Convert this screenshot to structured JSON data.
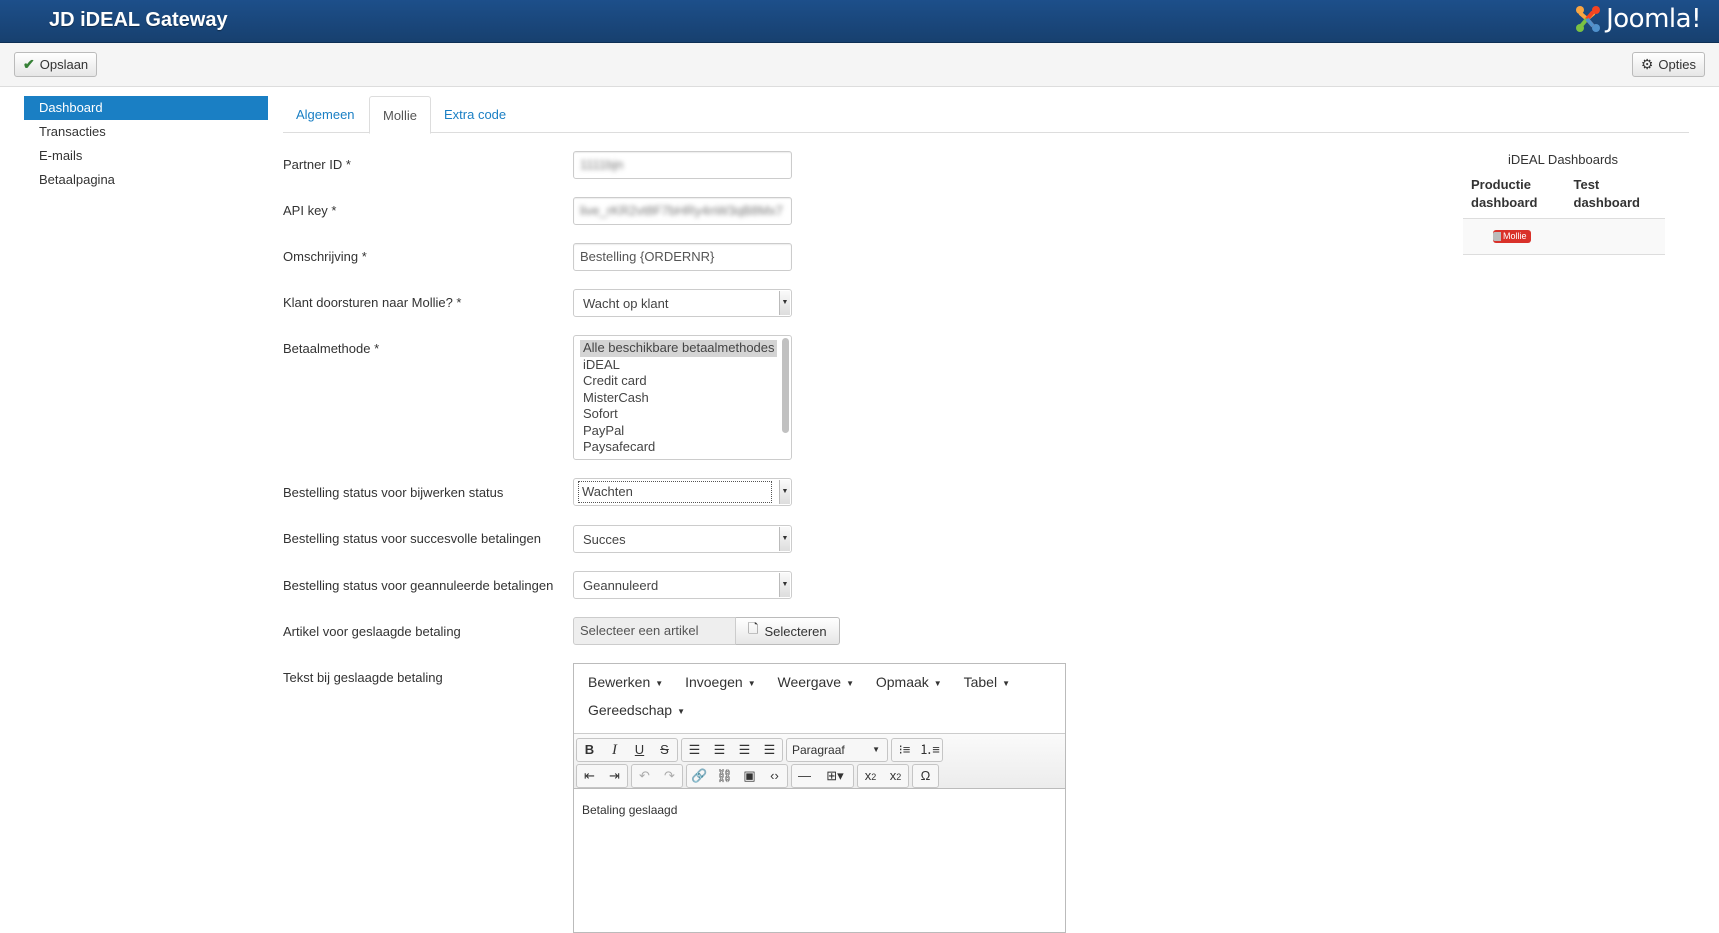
{
  "header": {
    "title": "JD iDEAL Gateway",
    "logo_text": "Joomla!"
  },
  "toolbar": {
    "save_label": "Opslaan",
    "options_label": "Opties"
  },
  "sidebar": {
    "items": [
      {
        "label": "Dashboard"
      },
      {
        "label": "Transacties"
      },
      {
        "label": "E-mails"
      },
      {
        "label": "Betaalpagina"
      }
    ]
  },
  "tabs": [
    {
      "label": "Algemeen"
    },
    {
      "label": "Mollie"
    },
    {
      "label": "Extra code"
    }
  ],
  "form": {
    "partner_id": {
      "label": "Partner ID *",
      "value": "1111bjn"
    },
    "api_key": {
      "label": "API key *",
      "value": "live_rKR2vt8F7bHRy4nW3qB8Mx7"
    },
    "description": {
      "label": "Omschrijving *",
      "value": "Bestelling {ORDERNR}"
    },
    "redirect": {
      "label": "Klant doorsturen naar Mollie? *",
      "value": "Wacht op klant"
    },
    "payment_method": {
      "label": "Betaalmethode *",
      "options": [
        "Alle beschikbare betaalmethodes",
        "iDEAL",
        "Credit card",
        "MisterCash",
        "Sofort",
        "PayPal",
        "Paysafecard"
      ]
    },
    "status_update": {
      "label": "Bestelling status voor bijwerken status",
      "value": "Wachten"
    },
    "status_success": {
      "label": "Bestelling status voor succesvolle betalingen",
      "value": "Succes"
    },
    "status_cancelled": {
      "label": "Bestelling status voor geannuleerde betalingen",
      "value": "Geannuleerd"
    },
    "article": {
      "label": "Artikel voor geslaagde betaling",
      "placeholder": "Selecteer een artikel",
      "button_label": "Selecteren"
    },
    "success_text": {
      "label": "Tekst bij geslaagde betaling"
    }
  },
  "editor": {
    "menu": [
      "Bewerken",
      "Invoegen",
      "Weergave",
      "Opmaak",
      "Tabel",
      "Gereedschap"
    ],
    "format_label": "Paragraaf",
    "content": "Betaling geslaagd"
  },
  "dashboards": {
    "title": "iDEAL Dashboards",
    "col_production": "Productie dashboard",
    "col_test": "Test dashboard",
    "badge": "Mollie"
  }
}
